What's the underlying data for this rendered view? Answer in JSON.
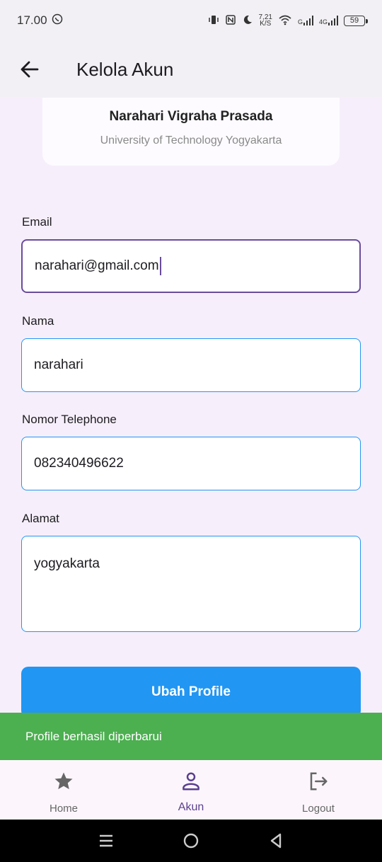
{
  "status_bar": {
    "time": "17.00",
    "net_speed_value": "7,21",
    "net_speed_unit": "K/S",
    "signal1_label": "G",
    "signal2_label": "4G",
    "battery": "59"
  },
  "app_bar": {
    "title": "Kelola Akun"
  },
  "profile": {
    "name": "Narahari Vigraha Prasada",
    "university": "University of Technology Yogyakarta"
  },
  "form": {
    "email_label": "Email",
    "email_value": "narahari@gmail.com",
    "name_label": "Nama",
    "name_value": "narahari",
    "phone_label": "Nomor Telephone",
    "phone_value": "082340496622",
    "address_label": "Alamat",
    "address_value": "yogyakarta",
    "submit_label": "Ubah Profile"
  },
  "snackbar": {
    "message": "Profile berhasil diperbarui"
  },
  "bottom_nav": {
    "items": [
      {
        "label": "Home",
        "icon": "star-icon"
      },
      {
        "label": "Akun",
        "icon": "person-icon",
        "active": true
      },
      {
        "label": "Logout",
        "icon": "logout-icon"
      }
    ]
  },
  "colors": {
    "accent": "#2196f3",
    "focus": "#6a4c9c",
    "snackbar": "#4caf50",
    "background": "#f6effb"
  }
}
